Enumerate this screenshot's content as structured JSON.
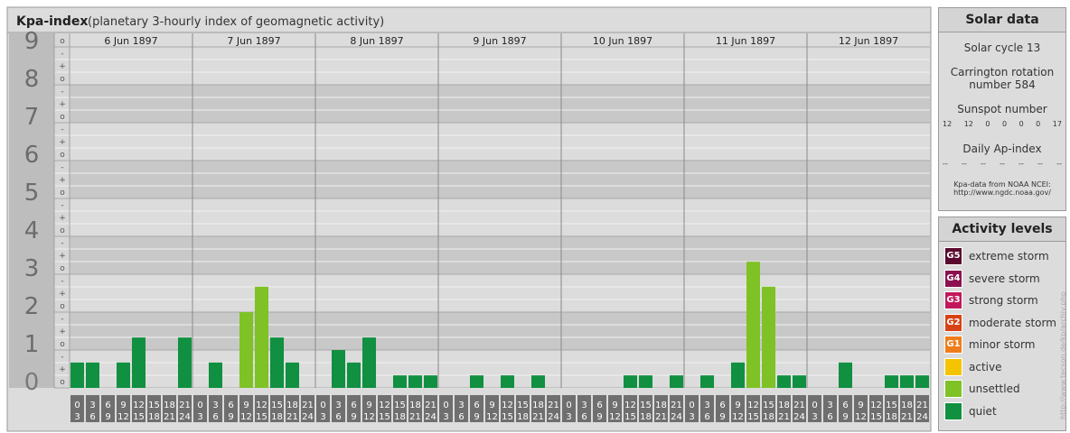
{
  "header": {
    "title": "Kpa-index",
    "subtitle": "(planetary 3-hourly index of geomagnetic activity)"
  },
  "solar": {
    "heading": "Solar data",
    "cycle": "Solar cycle 13",
    "rotation_line1": "Carrington rotation",
    "rotation_line2": "number 584",
    "sunspot_label": "Sunspot number",
    "sunspots": [
      "12",
      "12",
      "0",
      "0",
      "0",
      "0",
      "17"
    ],
    "ap_label": "Daily Ap-index",
    "ap_values": [
      "--",
      "--",
      "--",
      "--",
      "--",
      "--",
      "--"
    ],
    "source_line1": "Kpa-data from NOAA NCEI:",
    "source_line2": "http://www.ngdc.noaa.gov/"
  },
  "activity": {
    "heading": "Activity levels",
    "levels": [
      {
        "badge": "G5",
        "label": "extreme storm",
        "color": "#5a0a2e"
      },
      {
        "badge": "G4",
        "label": "severe storm",
        "color": "#8c1050"
      },
      {
        "badge": "G3",
        "label": "strong storm",
        "color": "#c2185b"
      },
      {
        "badge": "G2",
        "label": "moderate storm",
        "color": "#d84315"
      },
      {
        "badge": "G1",
        "label": "minor storm",
        "color": "#ef7d1a"
      },
      {
        "badge": "",
        "label": "active",
        "color": "#f5c400"
      },
      {
        "badge": "",
        "label": "unsettled",
        "color": "#7ec225"
      },
      {
        "badge": "",
        "label": "quiet",
        "color": "#109040"
      }
    ]
  },
  "credit": "http://www.tecson.de/kp/archiv.php",
  "chart_data": {
    "type": "bar",
    "title": "Kpa-index",
    "ylim": [
      0,
      9
    ],
    "y_ticks": [
      "0",
      "1",
      "2",
      "3",
      "4",
      "5",
      "6",
      "7",
      "8",
      "9"
    ],
    "sub_ticks": [
      "o",
      "+",
      "-"
    ],
    "days": [
      "6 Jun 1897",
      "7 Jun 1897",
      "8 Jun 1897",
      "9 Jun 1897",
      "10 Jun 1897",
      "11 Jun 1897",
      "12 Jun 1897"
    ],
    "interval_labels": [
      [
        "0",
        "3"
      ],
      [
        "3",
        "6"
      ],
      [
        "6",
        "9"
      ],
      [
        "9",
        "12"
      ],
      [
        "12",
        "15"
      ],
      [
        "15",
        "18"
      ],
      [
        "18",
        "21"
      ],
      [
        "21",
        "24"
      ]
    ],
    "values": [
      [
        0.67,
        0.67,
        0,
        0.67,
        1.33,
        0,
        0,
        1.33
      ],
      [
        0,
        0.67,
        0,
        2,
        2.67,
        1.33,
        0.67,
        0
      ],
      [
        0,
        1,
        0.67,
        1.33,
        0,
        0.33,
        0.33,
        0.33
      ],
      [
        0,
        0,
        0.33,
        0,
        0.33,
        0,
        0.33,
        0
      ],
      [
        0,
        0,
        0,
        0,
        0.33,
        0.33,
        0,
        0.33
      ],
      [
        0,
        0.33,
        0,
        0.67,
        3.33,
        2.67,
        0.33,
        0.33
      ],
      [
        0,
        0,
        0.67,
        0,
        0,
        0.33,
        0.33,
        0.33
      ]
    ],
    "colors": {
      "quiet": "#109040",
      "unsettled": "#7ec225"
    }
  }
}
